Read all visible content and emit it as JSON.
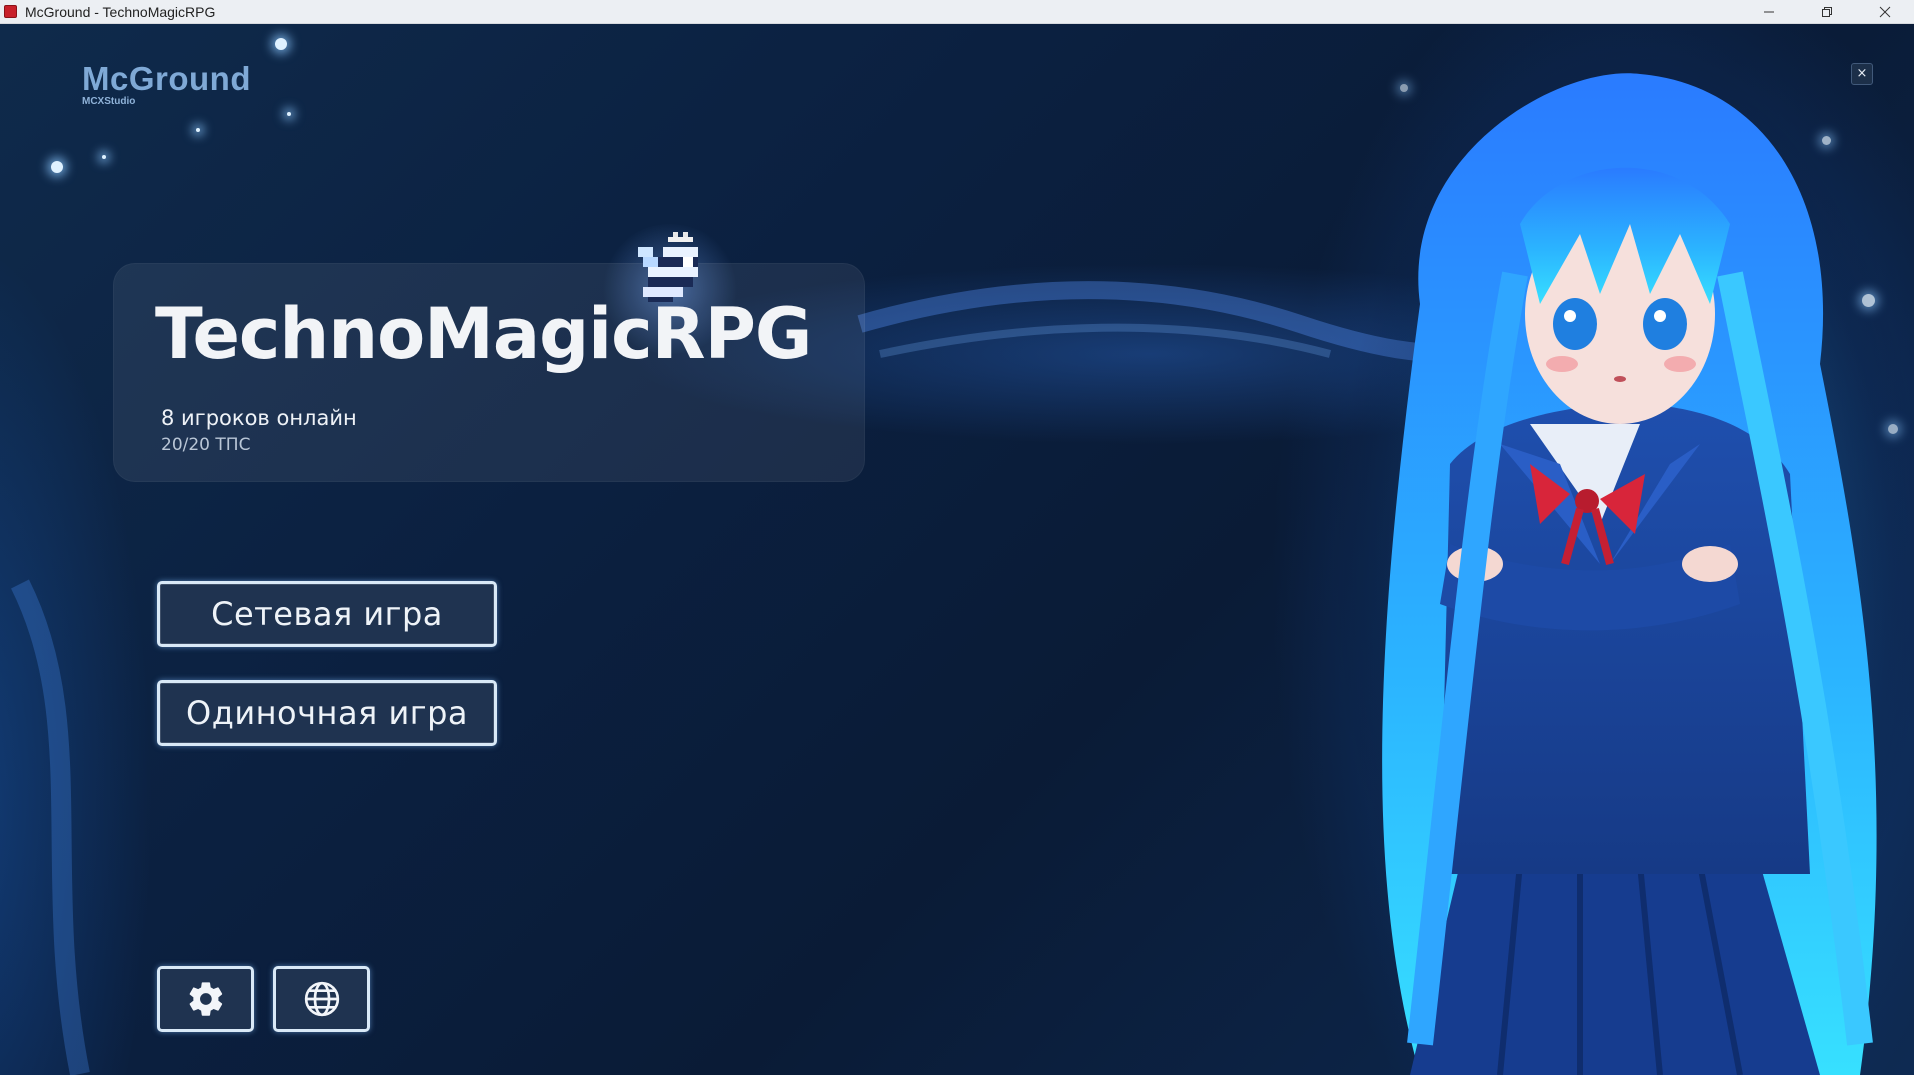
{
  "window": {
    "title": "McGround - TechnoMagicRPG",
    "controls": [
      "minimize-icon",
      "restore-icon",
      "close-icon"
    ]
  },
  "logo": {
    "title": "McGround",
    "subtitle": "MCXStudio"
  },
  "close_overlay": {
    "label": "×"
  },
  "server": {
    "name": "TechnoMagicRPG",
    "players_online": "8 игроков онлайн",
    "tps": "20/20 ТПС"
  },
  "menu": {
    "multiplayer_label": "Сетевая игра",
    "singleplayer_label": "Одиночная игра"
  },
  "toolbar": {
    "settings_icon": "gear-icon",
    "language_icon": "globe-icon"
  },
  "colors": {
    "background": "#0b1f38",
    "button_border": "#d9e9f7",
    "button_fill": "#1f3350",
    "accent_glow": "#2f8fff"
  }
}
